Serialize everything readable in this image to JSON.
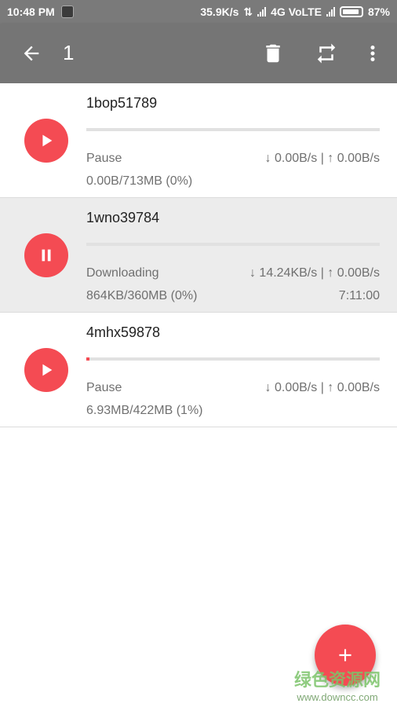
{
  "status_bar": {
    "time": "10:48 PM",
    "net_speed": "35.9K/s",
    "network": "4G VoLTE",
    "battery": "87%"
  },
  "toolbar": {
    "title": "1",
    "icons": [
      "back-arrow-icon",
      "delete-icon",
      "repeat-icon",
      "more-vert-icon"
    ]
  },
  "downloads": [
    {
      "name": "1bop51789",
      "status": "Pause",
      "speed": "↓ 0.00B/s | ↑ 0.00B/s",
      "size": "0.00B/713MB (0%)",
      "eta": "",
      "progress": 0,
      "state_icon": "play-icon"
    },
    {
      "name": "1wno39784",
      "status": "Downloading",
      "speed": "↓ 14.24KB/s | ↑ 0.00B/s",
      "size": "864KB/360MB (0%)",
      "eta": "7:11:00",
      "progress": 0,
      "state_icon": "pause-icon"
    },
    {
      "name": "4mhx59878",
      "status": "Pause",
      "speed": "↓ 0.00B/s | ↑ 0.00B/s",
      "size": "6.93MB/422MB (1%)",
      "eta": "",
      "progress": 1,
      "state_icon": "play-icon"
    }
  ],
  "fab": {
    "icon": "plus-icon"
  },
  "watermark": {
    "logo": "绿色资源网",
    "url": "www.downcc.com"
  },
  "colors": {
    "accent": "#f44b53",
    "toolbar": "#757575",
    "status_bar": "#7a7a7a"
  }
}
